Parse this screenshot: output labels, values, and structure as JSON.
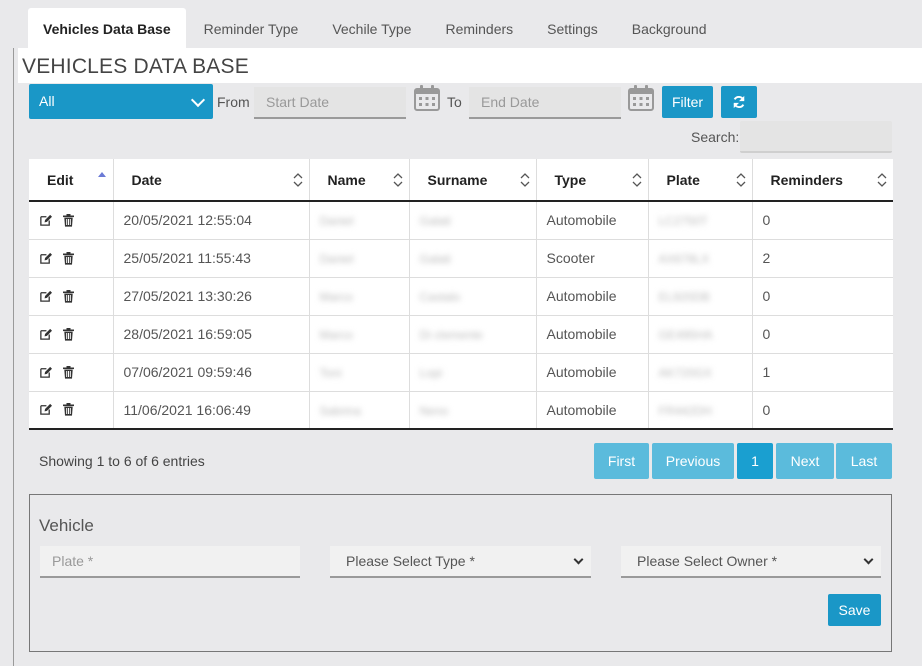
{
  "tabs": [
    "Vehicles Data Base",
    "Reminder Type",
    "Vechile Type",
    "Reminders",
    "Settings",
    "Background"
  ],
  "page_title": "VEHICLES DATA BASE",
  "filter": {
    "select_value": "All",
    "from_label": "From",
    "start_placeholder": "Start Date",
    "to_label": "To",
    "end_placeholder": "End Date",
    "filter_button": "Filter",
    "search_label": "Search:"
  },
  "table": {
    "headers": [
      "Edit",
      "Date",
      "Name",
      "Surname",
      "Type",
      "Plate",
      "Reminders"
    ],
    "rows": [
      {
        "date": "20/05/2021 12:55:04",
        "name": "Daniel",
        "surname": "Galati",
        "type": "Automobile",
        "plate": "LC2750T",
        "reminders": "0"
      },
      {
        "date": "25/05/2021 11:55:43",
        "name": "Daniel",
        "surname": "Galati",
        "type": "Scooter",
        "plate": "AX678LX",
        "reminders": "2"
      },
      {
        "date": "27/05/2021 13:30:26",
        "name": "Marco",
        "surname": "Castalo",
        "type": "Automobile",
        "plate": "EL920DB",
        "reminders": "0"
      },
      {
        "date": "28/05/2021 16:59:05",
        "name": "Marco",
        "surname": "Di clemente",
        "type": "Automobile",
        "plate": "GE495HA",
        "reminders": "0"
      },
      {
        "date": "07/06/2021 09:59:46",
        "name": "Toni",
        "surname": "Lopi",
        "type": "Automobile",
        "plate": "AK720GX",
        "reminders": "1"
      },
      {
        "date": "11/06/2021 16:06:49",
        "name": "Sabrina",
        "surname": "Neno",
        "type": "Automobile",
        "plate": "FR442DH",
        "reminders": "0"
      }
    ]
  },
  "info": "Showing 1 to 6 of 6 entries",
  "pagination": {
    "first": "First",
    "previous": "Previous",
    "current": "1",
    "next": "Next",
    "last": "Last"
  },
  "form": {
    "title": "Vehicle",
    "plate_placeholder": "Plate *",
    "type_select": "Please Select Type *",
    "owner_select": "Please Select Owner *",
    "save": "Save"
  },
  "colors": {
    "accent": "#1a97c7",
    "pagination": "#5bbbdc",
    "background": "#e9e9eb"
  },
  "icons": {
    "edit": "edit-icon",
    "delete": "trash-icon",
    "calendar": "calendar-icon",
    "refresh": "refresh-icon",
    "sort": "sort-icon"
  }
}
